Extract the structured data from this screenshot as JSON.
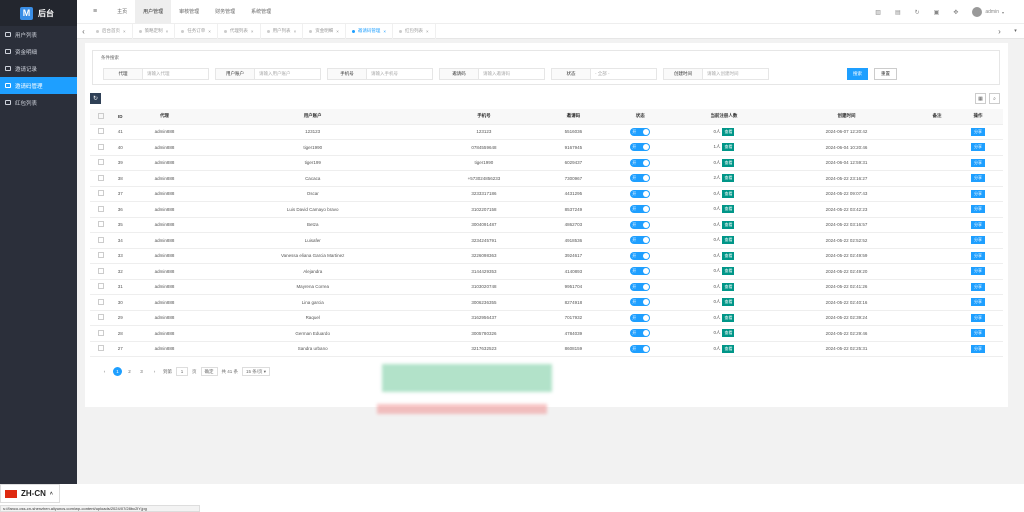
{
  "app": {
    "title": "后台",
    "logo_letter": "M"
  },
  "sidebar": {
    "items": [
      {
        "label": "用户列表",
        "active": false
      },
      {
        "label": "资金明细",
        "active": false
      },
      {
        "label": "邀请记录",
        "active": false
      },
      {
        "label": "邀请码管理",
        "active": true
      },
      {
        "label": "红包列表",
        "active": false
      }
    ]
  },
  "topbar": {
    "menu": [
      {
        "label": "主页",
        "active": false
      },
      {
        "label": "用户管理",
        "active": true
      },
      {
        "label": "审核管理",
        "active": false
      },
      {
        "label": "财务管理",
        "active": false
      },
      {
        "label": "系统管理",
        "active": false
      }
    ],
    "user": "admin"
  },
  "tabs": [
    {
      "label": "后台首页",
      "active": false
    },
    {
      "label": "策略定制",
      "active": false
    },
    {
      "label": "任务订单",
      "active": false
    },
    {
      "label": "代理列表",
      "active": false
    },
    {
      "label": "用户列表",
      "active": false
    },
    {
      "label": "资金明细",
      "active": false
    },
    {
      "label": "邀请码管理",
      "active": true
    },
    {
      "label": "红包列表",
      "active": false
    }
  ],
  "filter": {
    "title": "条件搜索",
    "fields": [
      {
        "label": "代理",
        "placeholder": "请输入代理"
      },
      {
        "label": "用户账户",
        "placeholder": "请输入用户账户"
      },
      {
        "label": "手机号",
        "placeholder": "请输入手机号"
      },
      {
        "label": "邀请码",
        "placeholder": "请输入邀请码"
      },
      {
        "label": "状态",
        "placeholder": "- 全部 -"
      },
      {
        "label": "创建时间",
        "placeholder": "请输入创建时间"
      }
    ],
    "search_label": "搜索",
    "reset_label": "重置"
  },
  "table": {
    "headers": [
      "",
      "ID",
      "代理",
      "用户账户",
      "手机号",
      "邀请码",
      "状态",
      "当前注册人数",
      "创建时间",
      "备注",
      "操作"
    ],
    "toggle_label": "开",
    "view_label": "查看",
    "share_label": "分享",
    "rows": [
      {
        "id": "41",
        "agent": "admin888",
        "account": "123123",
        "phone": "123123",
        "code": "5516036",
        "count": "0人",
        "created": "2024-06-07 12:20:42",
        "note": ""
      },
      {
        "id": "40",
        "agent": "admin888",
        "account": "tiger1990",
        "phone": "0784559648",
        "code": "9167945",
        "count": "1人",
        "created": "2024-06-04 10:20:46",
        "note": ""
      },
      {
        "id": "39",
        "agent": "admin888",
        "account": "tiger199",
        "phone": "tiger1990",
        "code": "6029437",
        "count": "0人",
        "created": "2024-06-04 12:59:31",
        "note": ""
      },
      {
        "id": "38",
        "agent": "admin888",
        "account": "Cacaca",
        "phone": "+573024856233",
        "code": "7300967",
        "count": "2人",
        "created": "2024-05-22 23:16:27",
        "note": ""
      },
      {
        "id": "37",
        "agent": "admin888",
        "account": "Oscar",
        "phone": "3233317186",
        "code": "4431295",
        "count": "0人",
        "created": "2024-05-22 09:07:43",
        "note": ""
      },
      {
        "id": "36",
        "agent": "admin888",
        "account": "Luis David Camayo bravo",
        "phone": "3102207158",
        "code": "8537249",
        "count": "0人",
        "created": "2024-05-22 03:42:23",
        "note": ""
      },
      {
        "id": "35",
        "agent": "admin888",
        "account": "Betza",
        "phone": "3004091487",
        "code": "4862703",
        "count": "0人",
        "created": "2024-05-22 03:16:57",
        "note": ""
      },
      {
        "id": "34",
        "agent": "admin888",
        "account": "Luisafer",
        "phone": "3234245791",
        "code": "4918536",
        "count": "0人",
        "created": "2024-05-22 02:52:52",
        "note": ""
      },
      {
        "id": "33",
        "agent": "admin888",
        "account": "Vanessa eliana Garcia Martinez",
        "phone": "3226098363",
        "code": "3924617",
        "count": "0人",
        "created": "2024-05-22 02:49:59",
        "note": ""
      },
      {
        "id": "32",
        "agent": "admin888",
        "account": "Alejandra",
        "phone": "3144429353",
        "code": "4140893",
        "count": "0人",
        "created": "2024-05-22 02:49:20",
        "note": ""
      },
      {
        "id": "31",
        "agent": "admin888",
        "account": "Mayrena Correa",
        "phone": "3103020748",
        "code": "9951704",
        "count": "0人",
        "created": "2024-05-22 02:41:26",
        "note": ""
      },
      {
        "id": "30",
        "agent": "admin888",
        "account": "Lina garcia",
        "phone": "3006236355",
        "code": "8274918",
        "count": "0人",
        "created": "2024-05-22 02:40:16",
        "note": ""
      },
      {
        "id": "29",
        "agent": "admin888",
        "account": "Raquel",
        "phone": "3162956437",
        "code": "7017932",
        "count": "0人",
        "created": "2024-05-22 02:39:24",
        "note": ""
      },
      {
        "id": "28",
        "agent": "admin888",
        "account": "German Eduardo",
        "phone": "3005780326",
        "code": "4784039",
        "count": "0人",
        "created": "2024-05-22 02:29:46",
        "note": ""
      },
      {
        "id": "27",
        "agent": "admin888",
        "account": "Sandra urbano",
        "phone": "3217632523",
        "code": "8608159",
        "count": "0人",
        "created": "2024-05-22 02:25:31",
        "note": ""
      }
    ]
  },
  "pager": {
    "pages": [
      "1",
      "2",
      "3"
    ],
    "goto_label": "到第",
    "goto_value": "1",
    "page_unit": "页",
    "confirm_label": "确定",
    "total": "共 41 条",
    "per_page": "15 条/页"
  },
  "language": "ZH-CN",
  "status_url": "s://fanco.oss-cn-shenzhen.aliyuncs.com/wp-content/uploads/2024/07/28bc2lY.jpg"
}
